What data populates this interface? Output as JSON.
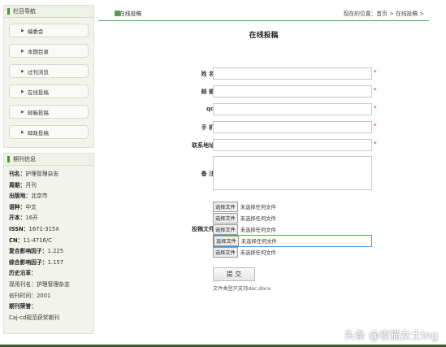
{
  "sidebar": {
    "nav_title": "栏目导航",
    "items": [
      {
        "label": "编委会"
      },
      {
        "label": "本期目录"
      },
      {
        "label": "过刊浏览"
      },
      {
        "label": "在线投稿"
      },
      {
        "label": "邮箱投稿"
      },
      {
        "label": "邮政投稿"
      }
    ],
    "info_title": "期刊信息",
    "info": [
      {
        "k": "刊名：",
        "v": "护理管理杂志"
      },
      {
        "k": "周期：",
        "v": "月刊"
      },
      {
        "k": "出版地：",
        "v": "北京市"
      },
      {
        "k": "语种：",
        "v": "中文"
      },
      {
        "k": "开本：",
        "v": "16开"
      },
      {
        "k": "ISSN：",
        "v": "1671-315X"
      },
      {
        "k": "CN：",
        "v": "11-4716/C"
      },
      {
        "k": "复合影响因子：",
        "v": "1.225"
      },
      {
        "k": "综合影响因子：",
        "v": "1.157"
      },
      {
        "k": "历史沿革：",
        "v": ""
      },
      {
        "k": "",
        "v": "现用刊名：护理管理杂志"
      },
      {
        "k": "",
        "v": "创刊时间：2001"
      },
      {
        "k": "期刊荣誉：",
        "v": ""
      },
      {
        "k": "",
        "v": "Caj-cd规范获奖期刊"
      }
    ]
  },
  "main": {
    "section_title": "在线投稿",
    "breadcrumb": "现在的位置：首页 > 在线投稿 >",
    "page_title": "在线投稿",
    "fields": [
      {
        "label": "姓 名",
        "value": "",
        "required": "*"
      },
      {
        "label": "邮 箱",
        "value": "",
        "required": "*"
      },
      {
        "label": "qq",
        "value": "",
        "required": "*"
      },
      {
        "label": "手 机",
        "value": "",
        "required": "*"
      },
      {
        "label": "联系地址",
        "value": "",
        "required": "*"
      }
    ],
    "remark_label": "备 注",
    "upload_label": "投稿文件",
    "file_button": "选择文件",
    "no_file": "未选择任何文件",
    "submit": "提 交",
    "hint": "文件类型只支持doc,docx"
  },
  "watermark": "头条 @夜猫女士ing"
}
